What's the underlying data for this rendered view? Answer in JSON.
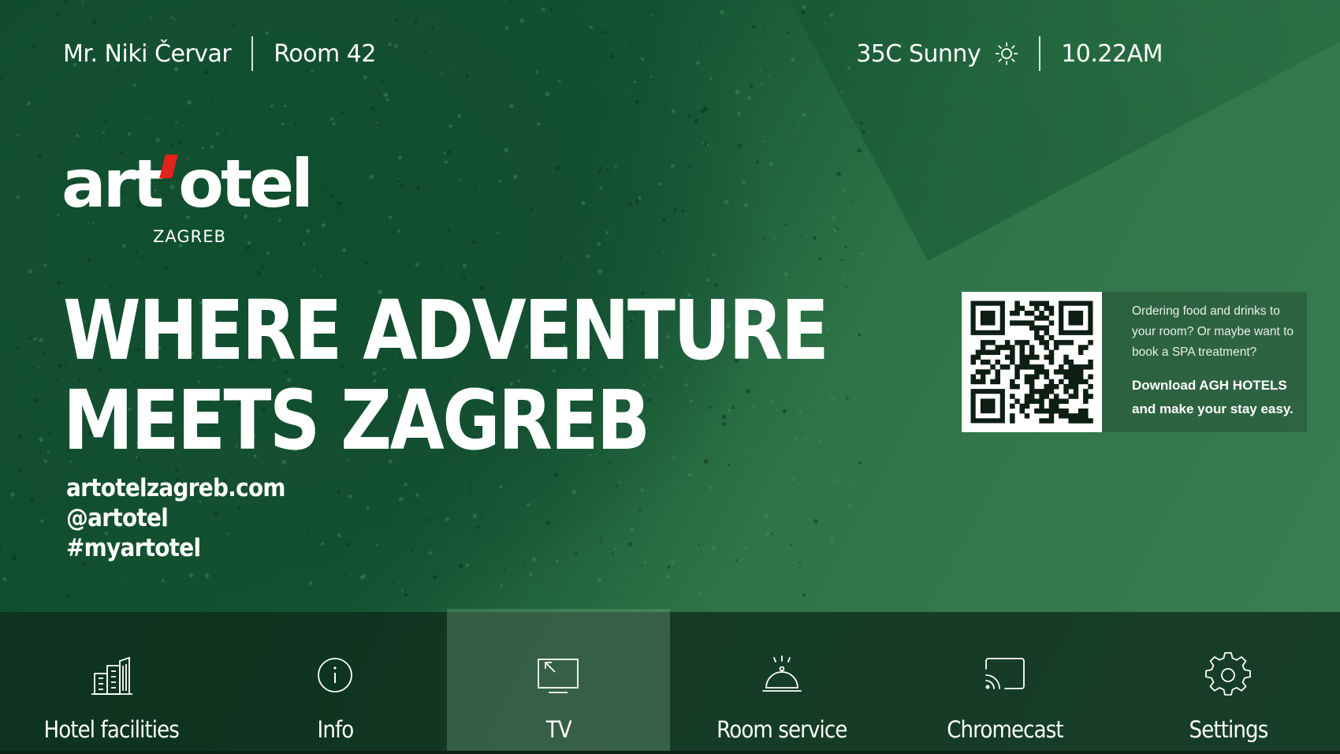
{
  "guest": {
    "name": "Mr. Niki Červar",
    "room": "Room 42"
  },
  "weather": {
    "text": "35C Sunny",
    "icon": "sun-icon"
  },
  "clock": {
    "time": "10.22AM"
  },
  "brand": {
    "logo_text": "art'otel",
    "city": "ZAGREB",
    "accent_color": "#e2231a"
  },
  "headline": {
    "line1": "WHERE ADVENTURE",
    "line2": "MEETS ZAGREB"
  },
  "links": [
    "artotelzagreb.com",
    "@artotel",
    "#myartotel"
  ],
  "promo": {
    "text": "Ordering food and drinks to your room? Or maybe want to book a SPA treatment?",
    "cta": "Download AGH HOTELS and make your stay easy."
  },
  "nav": {
    "active_index": 2,
    "items": [
      {
        "label": "Hotel facilities",
        "icon": "building-icon"
      },
      {
        "label": "Info",
        "icon": "info-icon"
      },
      {
        "label": "TV",
        "icon": "tv-icon"
      },
      {
        "label": "Room service",
        "icon": "cloche-icon"
      },
      {
        "label": "Chromecast",
        "icon": "cast-icon"
      },
      {
        "label": "Settings",
        "icon": "gear-icon"
      }
    ]
  },
  "colors": {
    "background": "#2b6a44",
    "nav_bar": "#0e2c1c",
    "nav_active": "#5f8d6f"
  }
}
